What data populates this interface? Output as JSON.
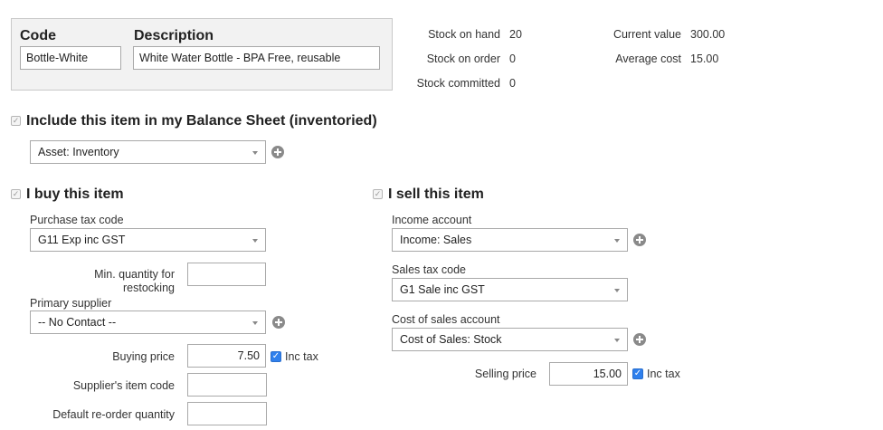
{
  "item": {
    "code_label": "Code",
    "code_value": "Bottle-White",
    "description_label": "Description",
    "description_value": "White Water Bottle - BPA Free, reusable"
  },
  "stock": {
    "on_hand_label": "Stock on hand",
    "on_hand_value": "20",
    "on_order_label": "Stock on order",
    "on_order_value": "0",
    "committed_label": "Stock committed",
    "committed_value": "0",
    "current_value_label": "Current value",
    "current_value_value": "300.00",
    "average_cost_label": "Average cost",
    "average_cost_value": "15.00"
  },
  "balance_sheet": {
    "checkbox_label": "Include this item in my Balance Sheet (inventoried)",
    "account_value": "Asset: Inventory"
  },
  "buy": {
    "section_label": "I buy this item",
    "purchase_tax_label": "Purchase tax code",
    "purchase_tax_value": "G11 Exp inc GST",
    "min_qty_label_line1": "Min. quantity for",
    "min_qty_label_line2": "restocking",
    "min_qty_value": "",
    "supplier_label": "Primary supplier",
    "supplier_value": "-- No Contact --",
    "buying_price_label": "Buying price",
    "buying_price_value": "7.50",
    "inc_tax_label": "Inc tax",
    "supplier_code_label": "Supplier's item code",
    "supplier_code_value": "",
    "reorder_label": "Default re-order quantity",
    "reorder_value": ""
  },
  "sell": {
    "section_label": "I sell this item",
    "income_account_label": "Income account",
    "income_account_value": "Income: Sales",
    "sales_tax_label": "Sales tax code",
    "sales_tax_value": "G1 Sale inc GST",
    "cost_of_sales_label": "Cost of sales account",
    "cost_of_sales_value": "Cost of Sales: Stock",
    "selling_price_label": "Selling price",
    "selling_price_value": "15.00",
    "inc_tax_label": "Inc tax"
  },
  "icons": {
    "add": "plus-circle-icon",
    "check": "checkmark-icon",
    "dropdown": "chevron-down-icon"
  },
  "colors": {
    "accent": "#2f80ed",
    "panel_bg": "#f2f2f2"
  }
}
